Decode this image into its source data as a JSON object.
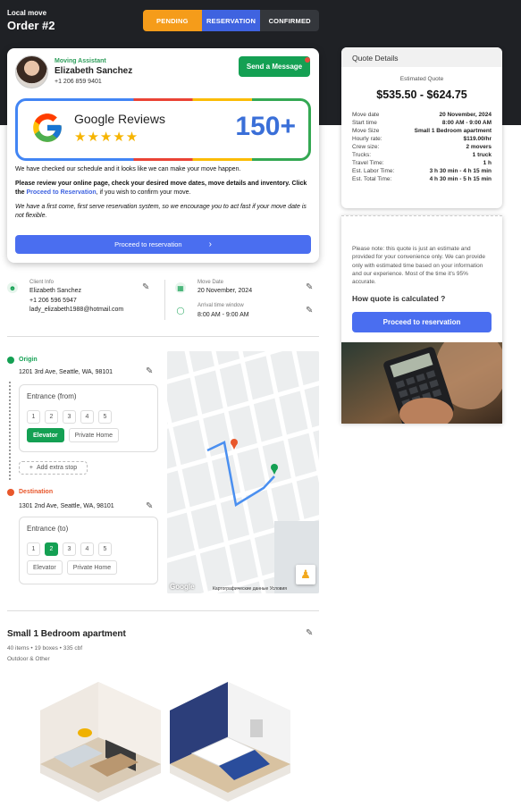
{
  "header": {
    "subtitle": "Local move",
    "title": "Order #2",
    "steps": [
      "PENDING",
      "RESERVATION",
      "CONFIRMED"
    ]
  },
  "assistant": {
    "label": "Moving Assistant",
    "name": "Elizabeth Sanchez",
    "phone": "+1 206 859 9401",
    "send_label": "Send a Message"
  },
  "reviews": {
    "title": "Google Reviews",
    "stars": "★★★★★",
    "count": "150+"
  },
  "messages": {
    "p1": "We have checked our schedule and it looks like we can make your move happen.",
    "p2_a": "Please review your online page, check your desired move dates, move details and inventory. Click the ",
    "p2_link": "Proceed to Reservation",
    "p2_b": ", if you wish to confirm your move.",
    "p3": "We have a first come, first serve reservation system, so we encourage you to act fast if your move date is not flexible.",
    "proceed_label": "Proceed to reservation"
  },
  "client": {
    "label": "Client Info",
    "name": "Elizabeth Sanchez",
    "phone": "+1 206 596 5947",
    "email": "lady_elizabeth1988@hotmail.com"
  },
  "move": {
    "date_label": "Move Date",
    "date": "20 November, 2024",
    "window_label": "Arrival time window",
    "window": "8:00 AM - 9:00 AM"
  },
  "origin": {
    "label": "Origin",
    "address": "1201 3rd Ave, Seattle, WA, 98101",
    "entrance_label": "Entrance (from)",
    "floors": [
      "1",
      "2",
      "3",
      "4",
      "5"
    ],
    "options": [
      "Elevator",
      "Private Home"
    ],
    "add_stop": "Add extra stop"
  },
  "destination": {
    "label": "Destination",
    "address": "1301 2nd Ave, Seattle, WA, 98101",
    "entrance_label": "Entrance (to)",
    "floors": [
      "1",
      "2",
      "3",
      "4",
      "5"
    ],
    "options": [
      "Elevator",
      "Private Home"
    ]
  },
  "map": {
    "google": "Google",
    "attribution": "Картографические данные    Условия"
  },
  "apartment": {
    "title": "Small 1 Bedroom apartment",
    "meta": "40 items • 19 boxes • 335 cbf",
    "meta2": "Outdoor & Other"
  },
  "quote": {
    "header": "Quote Details",
    "estimated_label": "Estimated Quote",
    "range": "$535.50 - $624.75",
    "rows": [
      {
        "k": "Move date",
        "v": "20 November, 2024"
      },
      {
        "k": "Start time",
        "v": "8:00 AM - 9:00 AM"
      },
      {
        "k": "Move Size",
        "v": "Small 1 Bedroom apartment"
      },
      {
        "k": "Hourly rate:",
        "v": "$119.00/hr"
      },
      {
        "k": "Crew size:",
        "v": "2 movers"
      },
      {
        "k": "Trucks:",
        "v": "1 truck"
      },
      {
        "k": "Travel Time:",
        "v": "1 h"
      },
      {
        "k": "Est. Labor Time:",
        "v": "3 h 30 min - 4 h 15 min"
      },
      {
        "k": "Est. Total Time:",
        "v": "4 h 30 min - 5 h 15 min"
      }
    ],
    "note": "Please note: this quote is just an estimate and provided for your convenience only. We can provide only with estimated time based on your information and our experience. Most of the time it's 95% accurate.",
    "how_title": "How quote is calculated ?",
    "proceed_label": "Proceed to reservation"
  }
}
